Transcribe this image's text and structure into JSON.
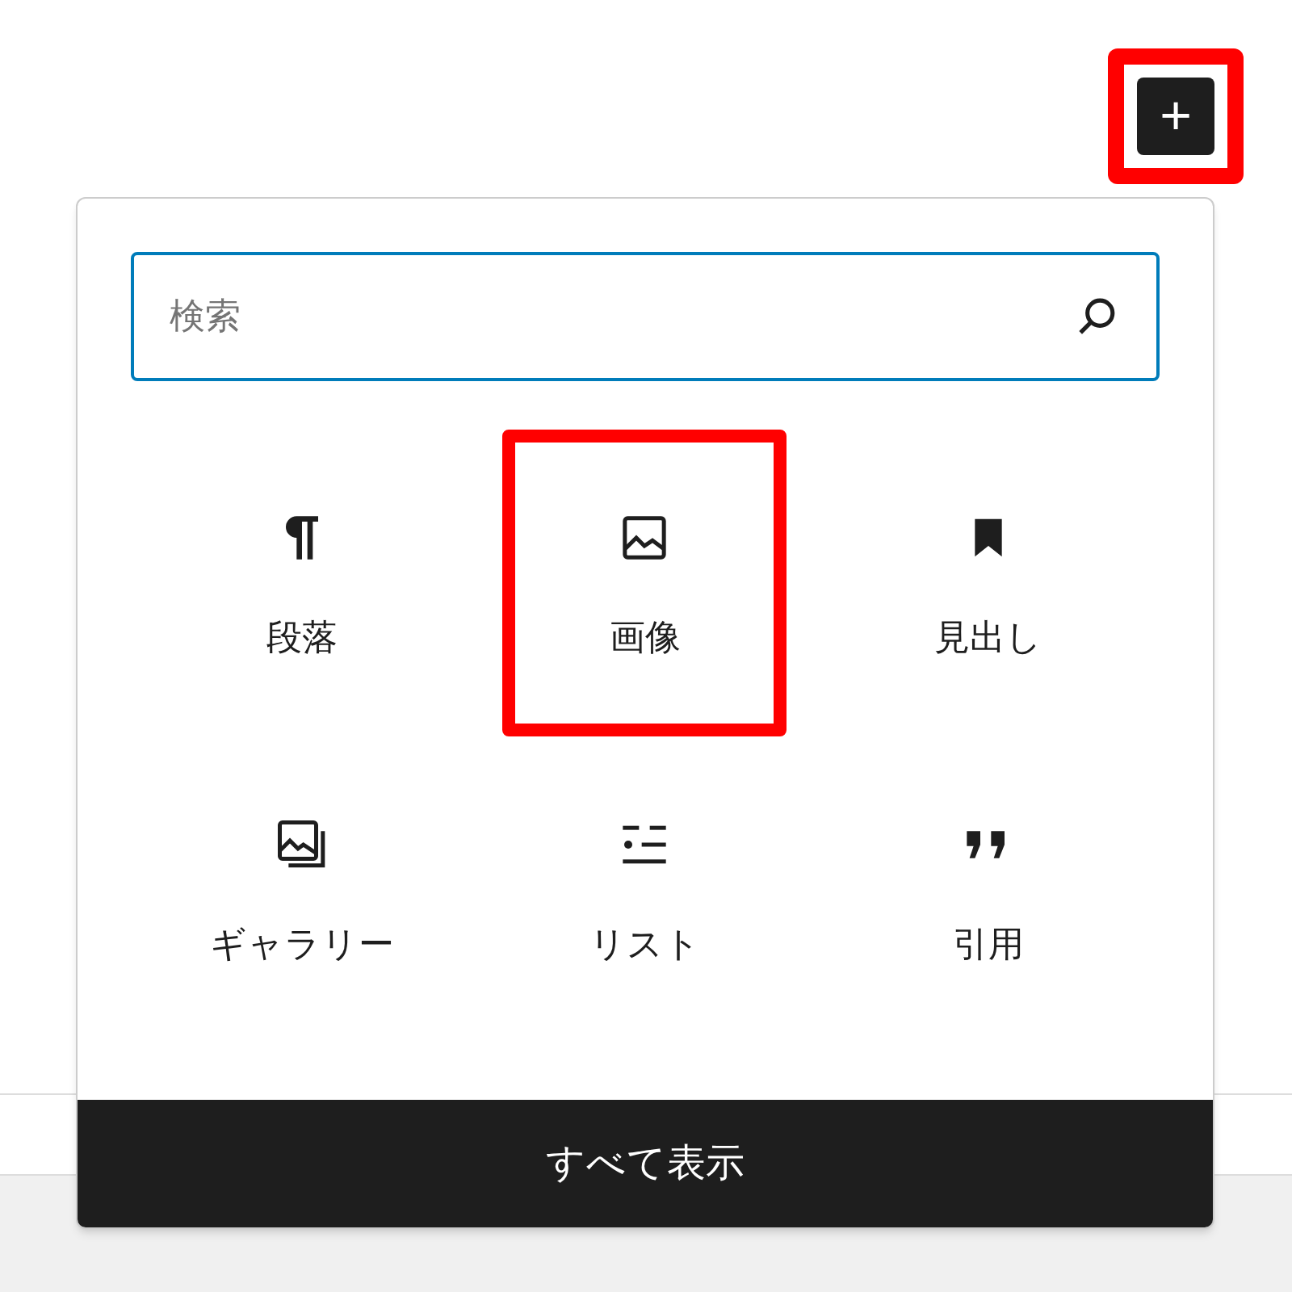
{
  "add_button": {
    "label": "+",
    "highlighted": true
  },
  "inserter": {
    "search": {
      "placeholder": "検索"
    },
    "blocks": [
      {
        "kind": "paragraph",
        "label": "段落",
        "highlighted": false
      },
      {
        "kind": "image",
        "label": "画像",
        "highlighted": true
      },
      {
        "kind": "heading",
        "label": "見出し",
        "highlighted": false
      },
      {
        "kind": "gallery",
        "label": "ギャラリー",
        "highlighted": false
      },
      {
        "kind": "list",
        "label": "リスト",
        "highlighted": false
      },
      {
        "kind": "quote",
        "label": "引用",
        "highlighted": false
      }
    ],
    "browse_all_button": "すべて表示"
  }
}
